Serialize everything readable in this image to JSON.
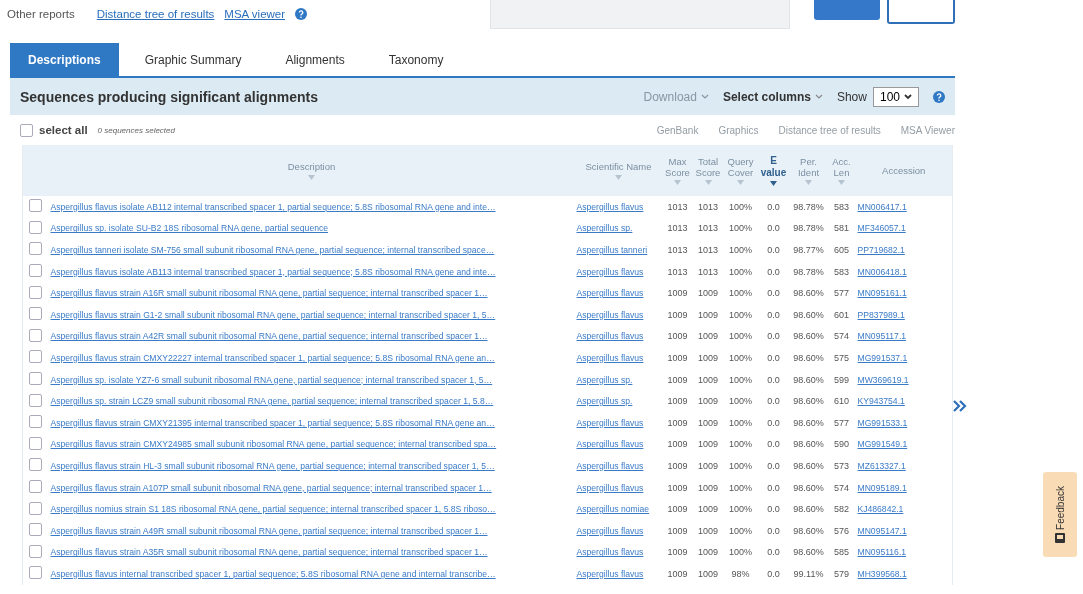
{
  "report_links": {
    "label": "Other reports",
    "links": [
      "Distance tree of results",
      "MSA viewer"
    ]
  },
  "top_buttons": [
    {
      "kind": "primary"
    },
    {
      "kind": "outline"
    }
  ],
  "tabs": [
    {
      "label": "Descriptions",
      "selected": true
    },
    {
      "label": "Graphic Summary",
      "selected": false
    },
    {
      "label": "Alignments",
      "selected": false
    },
    {
      "label": "Taxonomy",
      "selected": false
    }
  ],
  "results": {
    "title": "Sequences producing significant alignments",
    "download": {
      "label": "Download",
      "disabled": true
    },
    "select_columns": "Select columns",
    "show_label": "Show",
    "show_value": "100",
    "select_all": {
      "label": "select all",
      "checked": false
    },
    "selection_count": "0 sequences selected",
    "actions": [
      {
        "label": "GenBank",
        "disabled": true
      },
      {
        "label": "Graphics",
        "disabled": true
      },
      {
        "label": "Distance tree of results",
        "disabled": true
      },
      {
        "label": "MSA Viewer",
        "disabled": true
      }
    ]
  },
  "table": {
    "columns": [
      {
        "label": "Description",
        "sorted": false
      },
      {
        "label": "Scientific Name",
        "sorted": false
      },
      {
        "label": "Max Score",
        "sorted": false
      },
      {
        "label": "Total Score",
        "sorted": false
      },
      {
        "label": "Query Cover",
        "sorted": false
      },
      {
        "label": "E value",
        "sorted": true
      },
      {
        "label": "Per. Ident",
        "sorted": false
      },
      {
        "label": "Acc. Len",
        "sorted": false
      },
      {
        "label": "Accession",
        "sorted": false
      }
    ],
    "rows": [
      {
        "checked": false,
        "cells": [
          "Aspergillus flavus isolate AB112 internal transcribed spacer 1, partial sequence; 5.8S ribosomal RNA gene and inte…",
          "Aspergillus flavus",
          "1013",
          "1013",
          "100%",
          "0.0",
          "98.78%",
          "583",
          "MN006417.1"
        ]
      },
      {
        "checked": false,
        "cells": [
          "Aspergillus sp. isolate SU-B2 18S ribosomal RNA gene, partial sequence",
          "Aspergillus sp.",
          "1013",
          "1013",
          "100%",
          "0.0",
          "98.78%",
          "581",
          "MF346057.1"
        ]
      },
      {
        "checked": false,
        "cells": [
          "Aspergillus tanneri isolate SM-756 small subunit ribosomal RNA gene, partial sequence; internal transcribed space…",
          "Aspergillus tanneri",
          "1013",
          "1013",
          "100%",
          "0.0",
          "98.77%",
          "605",
          "PP719682.1"
        ]
      },
      {
        "checked": false,
        "cells": [
          "Aspergillus flavus isolate AB113 internal transcribed spacer 1, partial sequence; 5.8S ribosomal RNA gene and inte…",
          "Aspergillus flavus",
          "1013",
          "1013",
          "100%",
          "0.0",
          "98.78%",
          "583",
          "MN006418.1"
        ]
      },
      {
        "checked": false,
        "cells": [
          "Aspergillus flavus strain A16R small subunit ribosomal RNA gene, partial sequence; internal transcribed spacer 1…",
          "Aspergillus flavus",
          "1009",
          "1009",
          "100%",
          "0.0",
          "98.60%",
          "577",
          "MN095161.1"
        ]
      },
      {
        "checked": false,
        "cells": [
          "Aspergillus flavus strain G1-2 small subunit ribosomal RNA gene, partial sequence; internal transcribed spacer 1, 5…",
          "Aspergillus flavus",
          "1009",
          "1009",
          "100%",
          "0.0",
          "98.60%",
          "601",
          "PP837989.1"
        ]
      },
      {
        "checked": false,
        "cells": [
          "Aspergillus flavus strain A42R small subunit ribosomal RNA gene, partial sequence; internal transcribed spacer 1…",
          "Aspergillus flavus",
          "1009",
          "1009",
          "100%",
          "0.0",
          "98.60%",
          "574",
          "MN095117.1"
        ]
      },
      {
        "checked": false,
        "cells": [
          "Aspergillus flavus strain CMXY22227 internal transcribed spacer 1, partial sequence; 5.8S ribosomal RNA gene an…",
          "Aspergillus flavus",
          "1009",
          "1009",
          "100%",
          "0.0",
          "98.60%",
          "575",
          "MG991537.1"
        ]
      },
      {
        "checked": false,
        "cells": [
          "Aspergillus sp. isolate YZ7-6 small subunit ribosomal RNA gene, partial sequence; internal transcribed spacer 1, 5…",
          "Aspergillus sp.",
          "1009",
          "1009",
          "100%",
          "0.0",
          "98.60%",
          "599",
          "MW369619.1"
        ]
      },
      {
        "checked": false,
        "cells": [
          "Aspergillus sp. strain LCZ9 small subunit ribosomal RNA gene, partial sequence; internal transcribed spacer 1, 5.8…",
          "Aspergillus sp.",
          "1009",
          "1009",
          "100%",
          "0.0",
          "98.60%",
          "610",
          "KY943754.1"
        ]
      },
      {
        "checked": false,
        "cells": [
          "Aspergillus flavus strain CMXY21395 internal transcribed spacer 1, partial sequence; 5.8S ribosomal RNA gene an…",
          "Aspergillus flavus",
          "1009",
          "1009",
          "100%",
          "0.0",
          "98.60%",
          "577",
          "MG991533.1"
        ]
      },
      {
        "checked": false,
        "cells": [
          "Aspergillus flavus strain CMXY24985 small subunit ribosomal RNA gene, partial sequence; internal transcribed spa…",
          "Aspergillus flavus",
          "1009",
          "1009",
          "100%",
          "0.0",
          "98.60%",
          "590",
          "MG991549.1"
        ]
      },
      {
        "checked": false,
        "cells": [
          "Aspergillus flavus strain HL-3 small subunit ribosomal RNA gene, partial sequence; internal transcribed spacer 1, 5…",
          "Aspergillus flavus",
          "1009",
          "1009",
          "100%",
          "0.0",
          "98.60%",
          "573",
          "MZ613327.1"
        ]
      },
      {
        "checked": false,
        "cells": [
          "Aspergillus flavus strain A107P small subunit ribosomal RNA gene, partial sequence; internal transcribed spacer 1…",
          "Aspergillus flavus",
          "1009",
          "1009",
          "100%",
          "0.0",
          "98.60%",
          "574",
          "MN095189.1"
        ]
      },
      {
        "checked": false,
        "cells": [
          "Aspergillus nomius strain S1 18S ribosomal RNA gene, partial sequence; internal transcribed spacer 1, 5.8S riboso…",
          "Aspergillus nomiae",
          "1009",
          "1009",
          "100%",
          "0.0",
          "98.60%",
          "582",
          "KJ486842.1"
        ]
      },
      {
        "checked": false,
        "cells": [
          "Aspergillus flavus strain A49R small subunit ribosomal RNA gene, partial sequence; internal transcribed spacer 1…",
          "Aspergillus flavus",
          "1009",
          "1009",
          "100%",
          "0.0",
          "98.60%",
          "576",
          "MN095147.1"
        ]
      },
      {
        "checked": false,
        "cells": [
          "Aspergillus flavus strain A35R small subunit ribosomal RNA gene, partial sequence; internal transcribed spacer 1…",
          "Aspergillus flavus",
          "1009",
          "1009",
          "100%",
          "0.0",
          "98.60%",
          "585",
          "MN095116.1"
        ]
      },
      {
        "checked": false,
        "cells": [
          "Aspergillus flavus internal transcribed spacer 1, partial sequence; 5.8S ribosomal RNA gene and internal transcribe…",
          "Aspergillus flavus",
          "1009",
          "1009",
          "98%",
          "0.0",
          "99.11%",
          "579",
          "MH399568.1"
        ]
      }
    ]
  },
  "feedback": {
    "label": "Feedback"
  }
}
